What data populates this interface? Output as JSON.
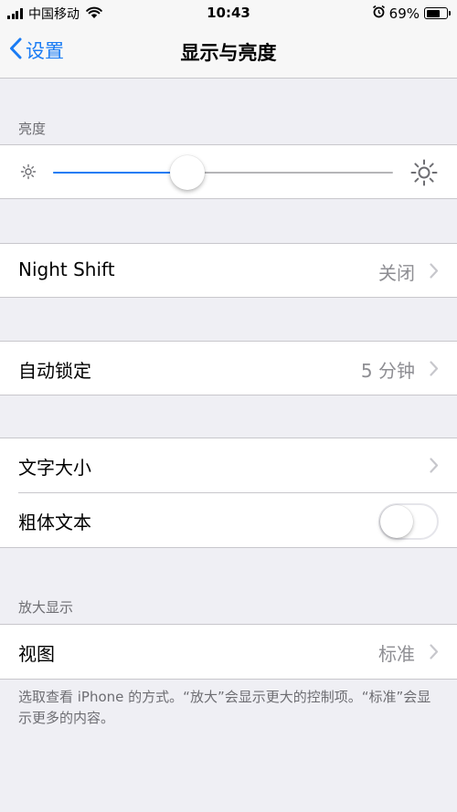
{
  "status_bar": {
    "carrier": "中国移动",
    "time": "10:43",
    "battery_percent": "69%",
    "battery_level": 0.69,
    "icons": [
      "signal-icon",
      "wifi-icon",
      "alarm-icon",
      "battery-icon"
    ]
  },
  "nav": {
    "back_label": "设置",
    "title": "显示与亮度"
  },
  "brightness": {
    "header": "亮度",
    "level": 0.395
  },
  "night_shift": {
    "label": "Night Shift",
    "value": "关闭"
  },
  "auto_lock": {
    "label": "自动锁定",
    "value": "5 分钟"
  },
  "text_size": {
    "label": "文字大小"
  },
  "bold_text": {
    "label": "粗体文本",
    "enabled": false
  },
  "zoom": {
    "header": "放大显示",
    "view_label": "视图",
    "view_value": "标准",
    "footer": "选取查看 iPhone 的方式。“放大”会显示更大的控制项。“标准”会显示更多的内容。"
  },
  "colors": {
    "accent": "#1a7cf4",
    "background": "#efeff4",
    "secondary_text": "#8e8e93"
  }
}
